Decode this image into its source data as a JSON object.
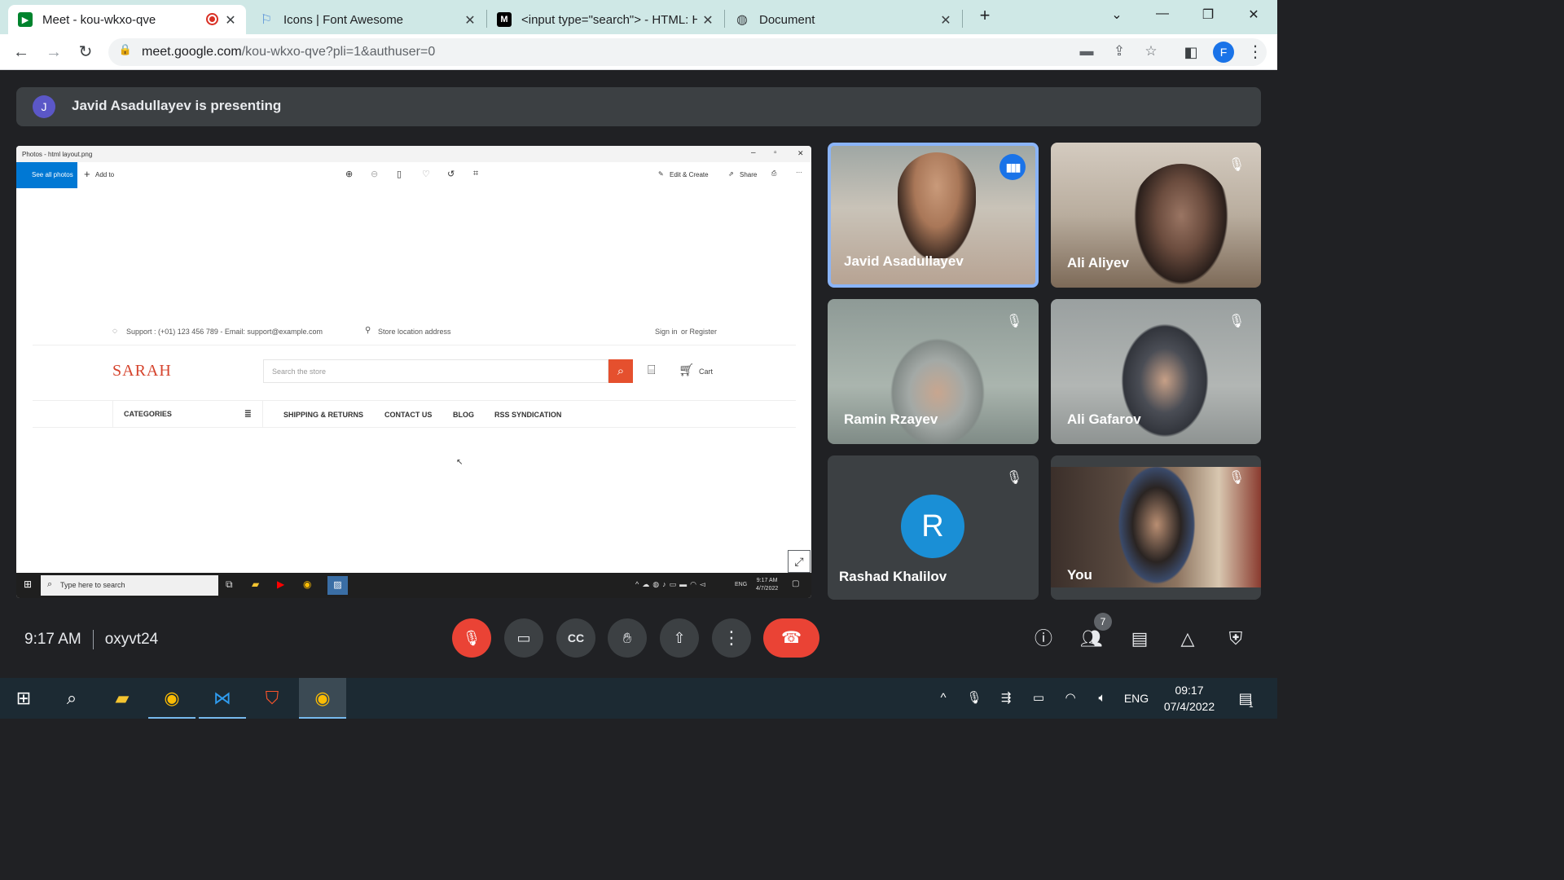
{
  "browser": {
    "tabs": [
      {
        "title": "Meet - kou-wkxo-qve",
        "favicon": "meet-icon"
      },
      {
        "title": "Icons | Font Awesome",
        "favicon": "flag-icon"
      },
      {
        "title": "<input type=\"search\"> - HTML: H",
        "favicon": "mdn-icon"
      },
      {
        "title": "Document",
        "favicon": "globe-icon"
      }
    ],
    "new_tab_label": "+",
    "url_host": "meet.google.com",
    "url_path": "/kou-wkxo-qve?pli=1&authuser=0",
    "profile_initial": "F"
  },
  "meet": {
    "presenting_avatar": "J",
    "presenting_text": "Javid Asadullayev is presenting",
    "shared_screen": {
      "window_title": "Photos - html layout.png",
      "see_all_photos": "See all photos",
      "add_to": "Add to",
      "edit_create": "Edit & Create",
      "share": "Share",
      "support_text": "Support : (+01) 123 456 789 - Email: support@example.com",
      "store_location": "Store location address",
      "sign_in": "Sign in",
      "or_register": "or Register",
      "logo": "SARAH",
      "search_placeholder": "Search the store",
      "cart": "Cart",
      "categories": "CATEGORIES",
      "nav": [
        "SHIPPING & RETURNS",
        "CONTACT US",
        "BLOG",
        "RSS SYNDICATION"
      ],
      "taskbar_search": "Type here to search",
      "taskbar_time": "9:17 AM",
      "taskbar_date": "4/7/2022",
      "taskbar_lang": "ENG"
    },
    "participants": [
      {
        "name": "Javid Asadullayev",
        "state": "speaking"
      },
      {
        "name": "Ali Aliyev",
        "state": "muted"
      },
      {
        "name": "Ramin Rzayev",
        "state": "muted"
      },
      {
        "name": "Ali Gafarov",
        "state": "muted"
      },
      {
        "name": "Rashad Khalilov",
        "state": "muted",
        "avatar": "R"
      },
      {
        "name": "You",
        "state": "muted"
      }
    ],
    "time": "9:17 AM",
    "meeting_code": "oxyvt24",
    "people_count": "7"
  },
  "taskbar": {
    "lang": "ENG",
    "time": "09:17",
    "date": "07/4/2022",
    "notifications": "1"
  },
  "colors": {
    "meet_bg": "#202124",
    "tile_bg": "#3c4043",
    "danger": "#ea4335",
    "accent": "#1a73e8",
    "tab_strip": "#cfe8e6"
  }
}
